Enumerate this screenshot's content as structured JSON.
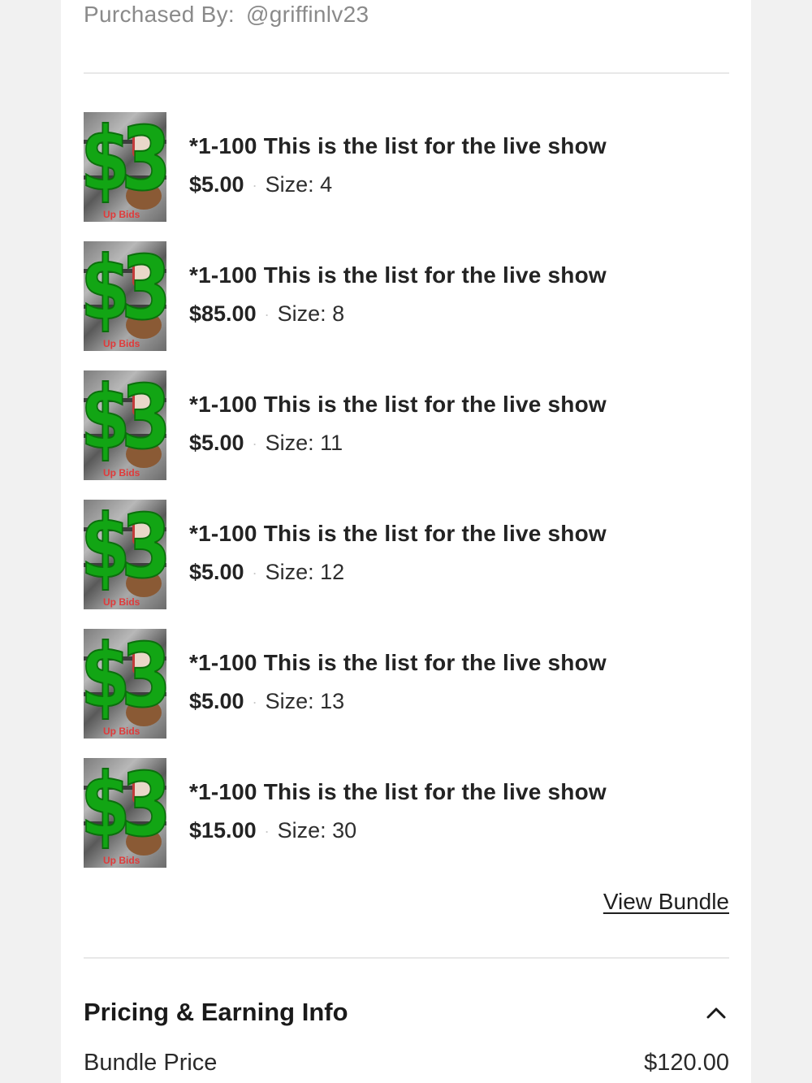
{
  "order": {
    "purchased_by_label": "Purchased By:",
    "purchased_by_handle": "@griffinlv23"
  },
  "items": [
    {
      "title": "*1-100 This is the list for the live show",
      "price": "$5.00",
      "size": "Size: 4"
    },
    {
      "title": "*1-100 This is the list for the live show",
      "price": "$85.00",
      "size": "Size: 8"
    },
    {
      "title": "*1-100 This is the list for the live show",
      "price": "$5.00",
      "size": "Size: 11"
    },
    {
      "title": "*1-100 This is the list for the live show",
      "price": "$5.00",
      "size": "Size: 12"
    },
    {
      "title": "*1-100 This is the list for the live show",
      "price": "$5.00",
      "size": "Size: 13"
    },
    {
      "title": "*1-100 This is the list for the live show",
      "price": "$15.00",
      "size": "Size: 30"
    }
  ],
  "thumbnail": {
    "overlay_text": "$3",
    "tag_text": "Up Bids"
  },
  "separator": "·",
  "view_bundle_label": "View Bundle",
  "pricing": {
    "section_title": "Pricing & Earning Info",
    "expand_icon": "chevron-up-icon",
    "rows": [
      {
        "label": "Bundle Price",
        "value": "$120.00"
      }
    ]
  },
  "colors": {
    "overlay_green": "#12a514",
    "divider": "#e8e8e8",
    "muted_text": "#8a8a8a"
  }
}
